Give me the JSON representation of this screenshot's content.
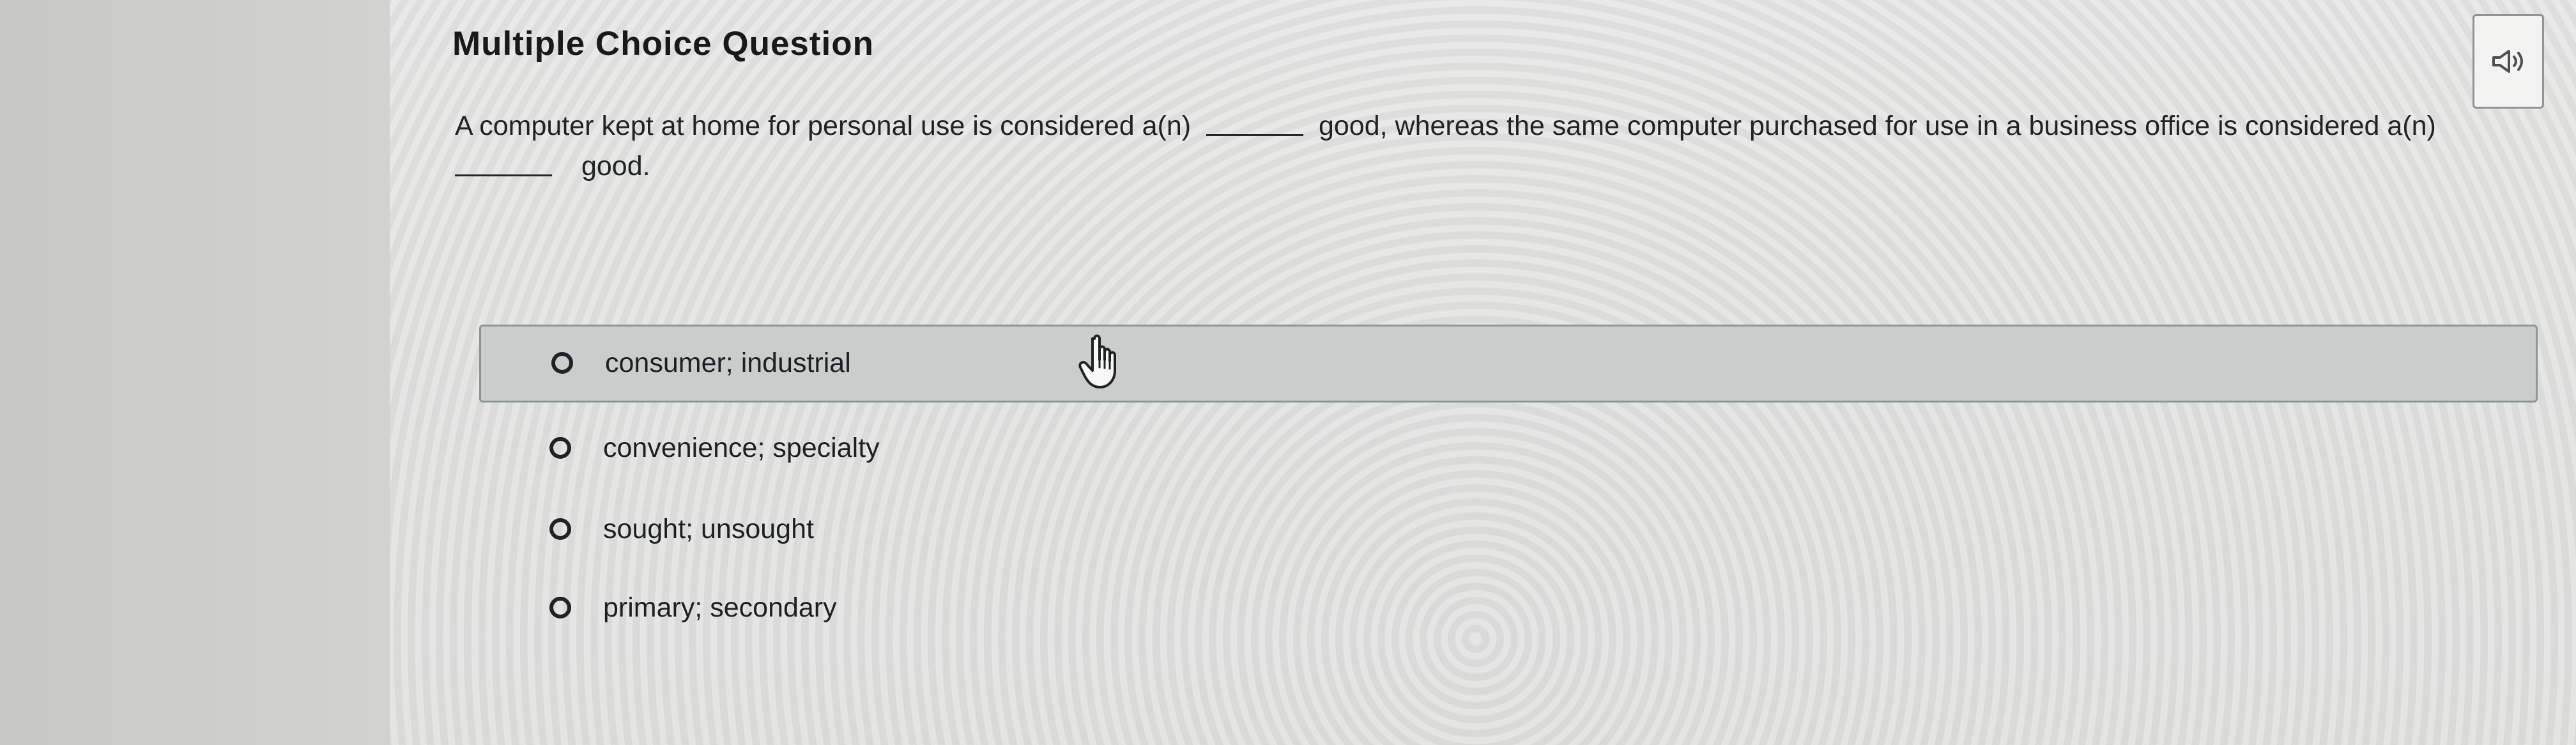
{
  "question": {
    "title": "Multiple Choice Question",
    "line_1_start": "A computer kept at home for personal use is considered a(n)",
    "line_1_end": "good, whereas the same computer purchased for use in a business office is considered a(n)",
    "line_2_end": "good."
  },
  "answers": [
    {
      "label": "consumer; industrial",
      "selected": true
    },
    {
      "label": "convenience; specialty",
      "selected": false
    },
    {
      "label": "sought; unsought",
      "selected": false
    },
    {
      "label": "primary; secondary",
      "selected": false
    }
  ],
  "icons": {
    "audio": "speaker-icon",
    "radio": "radio-icon",
    "cursor": "hand-pointer-icon"
  },
  "colors": {
    "page_background": "#d6d7d5",
    "content_background": "#e1e2e0",
    "selected_row": "#c9cecc",
    "text": "#1f2326"
  }
}
